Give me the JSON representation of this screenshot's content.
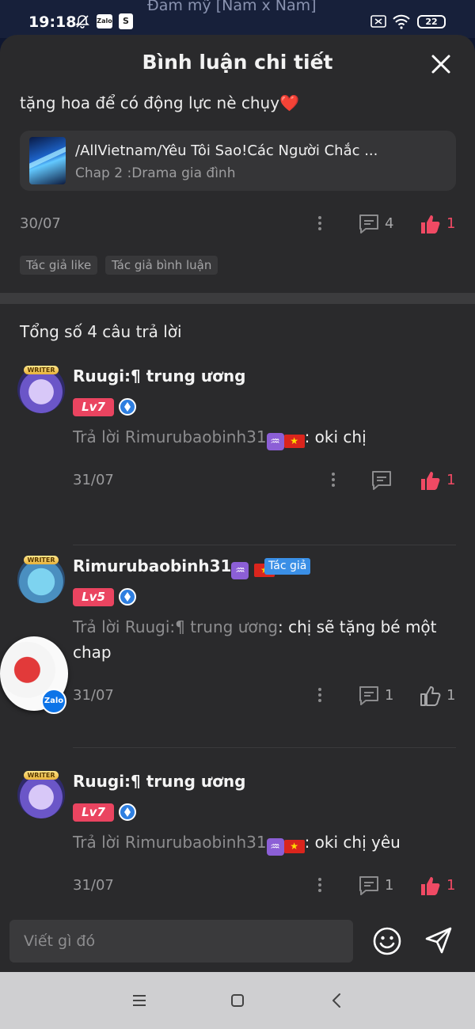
{
  "status_bar": {
    "time": "19:18",
    "background_title": "Đam mỹ [Nam x Nam]",
    "zalo_label": "Zalo",
    "battery": "22",
    "icons": [
      "mute-icon",
      "zalo-icon",
      "shopee-icon",
      "sim-off-icon",
      "wifi-icon",
      "battery-icon"
    ]
  },
  "sheet": {
    "title": "Bình luận chi tiết"
  },
  "parent_comment": {
    "text": "tặng hoa để có động lực nè chụy",
    "emoji": "❤️",
    "story": {
      "title": "/AllVietnam/Yêu Tôi Sao!Các Người Chắc ...",
      "chapter": "Chap 2 :Drama gia đình"
    },
    "date": "30/07",
    "comment_count": "4",
    "like_count": "1",
    "tags": [
      "Tác giả like",
      "Tác giả bình luận"
    ]
  },
  "replies_total": "Tổng số 4 câu trả lời",
  "replies": [
    {
      "username": "Ruugi:¶ trung ương",
      "level": "Lv7",
      "avatar_badge": "WRITER",
      "reply_prefix": "Trả lời Rimurubaobinh31",
      "reply_text": ": oki chị",
      "date": "31/07",
      "comment_count": "",
      "like_count": "1",
      "liked": true
    },
    {
      "username": "Rimurubaobinh31",
      "author_badge": "Tác giả",
      "level": "Lv5",
      "avatar_badge": "WRITER",
      "reply_prefix": "Trả lời Ruugi:¶ trung ương",
      "reply_text": ": chị sẽ tặng bé một chap",
      "date": "31/07",
      "comment_count": "1",
      "like_count": "1",
      "liked": false
    },
    {
      "username": "Ruugi:¶ trung ương",
      "level": "Lv7",
      "avatar_badge": "WRITER",
      "reply_prefix": "Trả lời Rimurubaobinh31",
      "reply_text": ": oki chị yêu",
      "date": "31/07",
      "comment_count": "1",
      "like_count": "1",
      "liked": true
    }
  ],
  "symbols": {
    "aquarius": "♒",
    "flag_star": "★"
  },
  "floating_zalo": {
    "label": "Zalo"
  },
  "input": {
    "placeholder": "Viết gì đó"
  },
  "colors": {
    "accent_pink": "#f04a64",
    "author_blue": "#3a8fe6",
    "sheet_bg": "#2a2a2c"
  }
}
